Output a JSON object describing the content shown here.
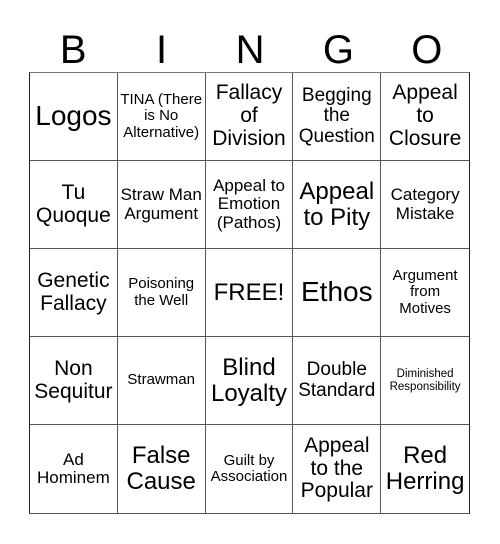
{
  "header": {
    "letters": [
      "B",
      "I",
      "N",
      "G",
      "O"
    ]
  },
  "cells": [
    "Logos",
    "TINA (There is No Alternative)",
    "Fallacy of Division",
    "Begging the Question",
    "Appeal to Closure",
    "Tu Quoque",
    "Straw Man Argument",
    "Appeal to Emotion (Pathos)",
    "Appeal to Pity",
    "Category Mistake",
    "Genetic Fallacy",
    "Poisoning the Well",
    "FREE!",
    "Ethos",
    "Argument from Motives",
    "Non Sequitur",
    "Strawman",
    "Blind Loyalty",
    "Double Standard",
    "Diminished Responsibility",
    "Ad Hominem",
    "False Cause",
    "Guilt by Association",
    "Appeal to the Popular",
    "Red Herring"
  ]
}
